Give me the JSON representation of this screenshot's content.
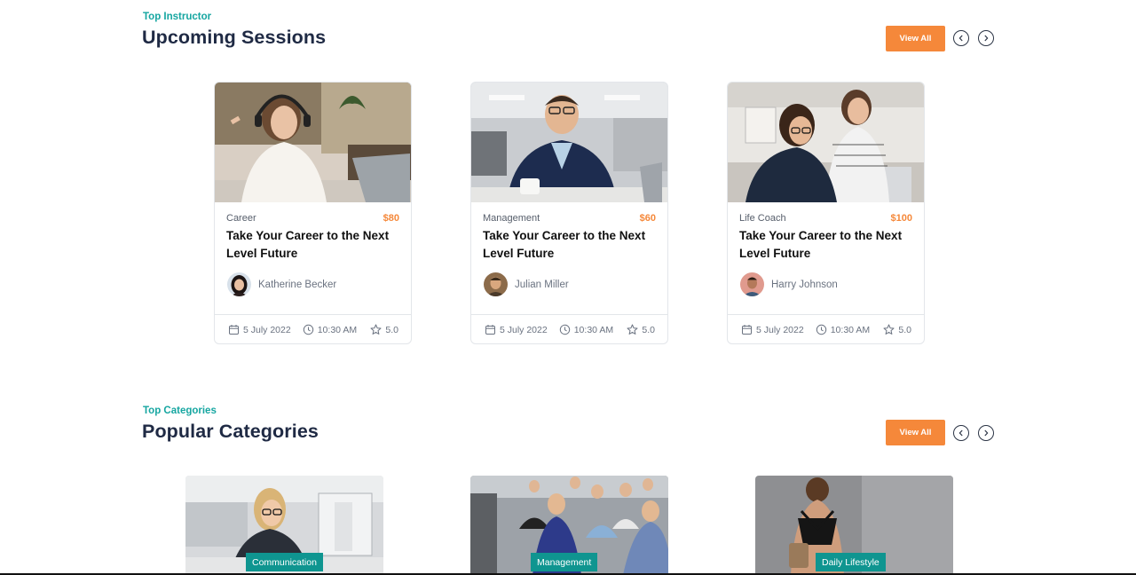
{
  "sessions": {
    "eyebrow": "Top Instructor",
    "title": "Upcoming Sessions",
    "view_all": "View All",
    "cards": [
      {
        "category": "Career",
        "price": "$80",
        "title": "Take Your Career to the Next Level Future",
        "author": "Katherine Becker",
        "date": "5 July 2022",
        "time": "10:30 AM",
        "rating": "5.0"
      },
      {
        "category": "Management",
        "price": "$60",
        "title": "Take Your Career to the Next Level Future",
        "author": "Julian Miller",
        "date": "5 July 2022",
        "time": "10:30 AM",
        "rating": "5.0"
      },
      {
        "category": "Life Coach",
        "price": "$100",
        "title": "Take Your Career to the Next Level Future",
        "author": "Harry Johnson",
        "date": "5 July 2022",
        "time": "10:30 AM",
        "rating": "5.0"
      }
    ]
  },
  "categories": {
    "eyebrow": "Top Categories",
    "title": "Popular Categories",
    "view_all": "View All",
    "items": [
      {
        "label": "Communication"
      },
      {
        "label": "Management"
      },
      {
        "label": "Daily Lifestyle"
      }
    ]
  },
  "colors": {
    "accent": "#f5883a",
    "teal": "#16a6a1",
    "badge": "#0f9590",
    "heading": "#1f2a44"
  },
  "icons": [
    "chevron-left-icon",
    "chevron-right-icon",
    "calendar-icon",
    "clock-icon",
    "star-icon"
  ]
}
